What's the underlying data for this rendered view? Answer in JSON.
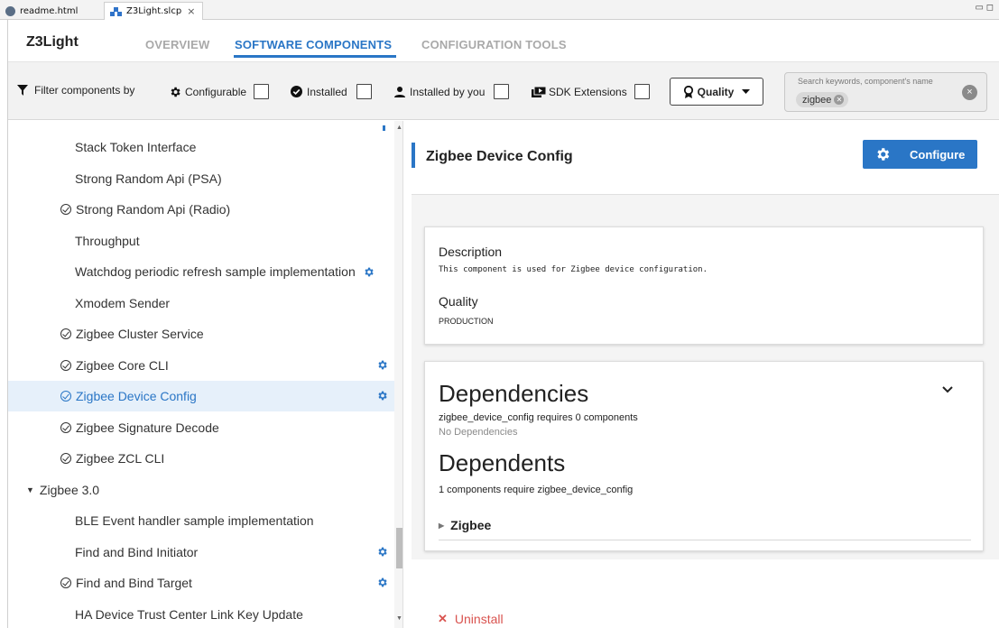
{
  "editor_tabs": [
    {
      "label": "readme.html",
      "icon": "globe-icon"
    },
    {
      "label": "Z3Light.slcp",
      "icon": "project-icon",
      "close": "×"
    }
  ],
  "window_controls": "▭ ◻",
  "app": {
    "title": "Z3Light"
  },
  "nav": {
    "tabs": [
      {
        "label": "OVERVIEW",
        "active": false
      },
      {
        "label": "SOFTWARE COMPONENTS",
        "active": true
      },
      {
        "label": "CONFIGURATION TOOLS",
        "active": false
      }
    ]
  },
  "filters": {
    "prefix": "Filter components by",
    "configurable": "Configurable",
    "installed": "Installed",
    "installed_by_you": "Installed by you",
    "sdk_extensions": "SDK Extensions",
    "quality": "Quality"
  },
  "search": {
    "placeholder": "Search keywords, component's name",
    "chip": "zigbee",
    "clear": "×"
  },
  "tree": {
    "items": [
      {
        "label": "Stack Token Interface",
        "installed": false,
        "configurable": false
      },
      {
        "label": "Strong Random Api (PSA)",
        "installed": false,
        "configurable": false
      },
      {
        "label": "Strong Random Api (Radio)",
        "installed": true,
        "configurable": false
      },
      {
        "label": "Throughput",
        "installed": false,
        "configurable": false
      },
      {
        "label": "Watchdog periodic refresh sample implementation",
        "installed": false,
        "configurable": true
      },
      {
        "label": "Xmodem Sender",
        "installed": false,
        "configurable": false
      },
      {
        "label": "Zigbee Cluster Service",
        "installed": true,
        "configurable": false
      },
      {
        "label": "Zigbee Core CLI",
        "installed": true,
        "configurable": true
      },
      {
        "label": "Zigbee Device Config",
        "installed": true,
        "configurable": true,
        "selected": true
      },
      {
        "label": "Zigbee Signature Decode",
        "installed": true,
        "configurable": false
      },
      {
        "label": "Zigbee ZCL CLI",
        "installed": true,
        "configurable": false
      },
      {
        "label": "Zigbee 3.0",
        "category": true,
        "expanded": true
      },
      {
        "label": "BLE Event handler sample implementation",
        "installed": false,
        "configurable": false
      },
      {
        "label": "Find and Bind Initiator",
        "installed": false,
        "configurable": true
      },
      {
        "label": "Find and Bind Target",
        "installed": true,
        "configurable": true
      },
      {
        "label": "HA Device Trust Center Link Key Update",
        "installed": false,
        "configurable": false
      }
    ]
  },
  "detail": {
    "title": "Zigbee Device Config",
    "configure_label": "Configure",
    "description_label": "Description",
    "description_text": "This component is used for Zigbee device configuration.",
    "quality_label": "Quality",
    "quality_value": "PRODUCTION",
    "dependencies_title": "Dependencies",
    "dependencies_summary": "zigbee_device_config requires 0 components",
    "no_dependencies": "No Dependencies",
    "dependents_title": "Dependents",
    "dependents_summary": "1 components require zigbee_device_config",
    "dependent_item": "Zigbee",
    "uninstall_label": "Uninstall"
  },
  "colors": {
    "accent": "#2a76c6",
    "danger": "#d9534f",
    "selected_bg": "#e6f0fa"
  }
}
